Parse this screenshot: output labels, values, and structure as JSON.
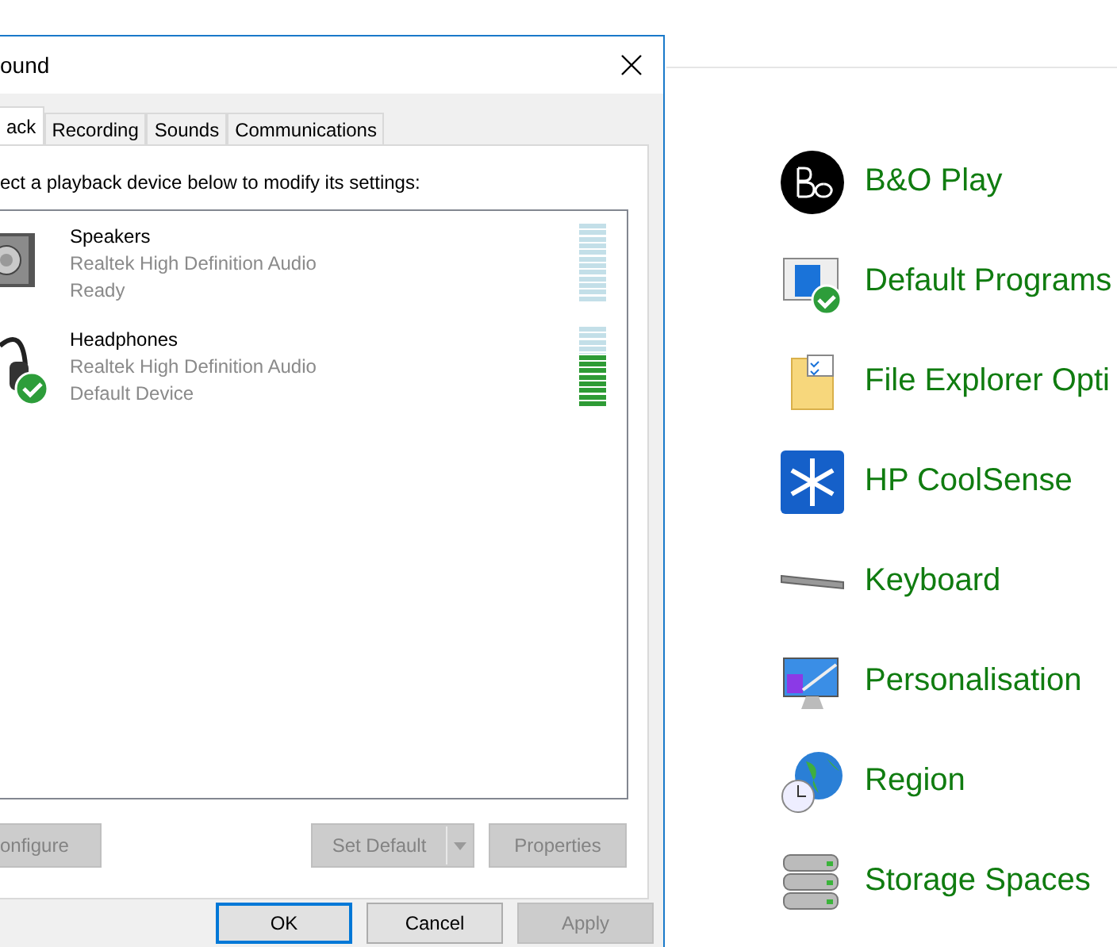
{
  "dialog": {
    "title": "ound",
    "tabs": [
      {
        "label": "ack",
        "selected": true
      },
      {
        "label": "Recording",
        "selected": false
      },
      {
        "label": "Sounds",
        "selected": false
      },
      {
        "label": "Communications",
        "selected": false
      }
    ],
    "instruction": "ect a playback device below to modify its settings:",
    "devices": [
      {
        "kind": "speaker",
        "name": "Speakers",
        "driver": "Realtek High Definition Audio",
        "status": "Ready",
        "default": false,
        "level": 0
      },
      {
        "kind": "headphones",
        "name": "Headphones",
        "driver": "Realtek High Definition Audio",
        "status": "Default Device",
        "default": true,
        "level": 0.67
      }
    ],
    "device_buttons": [
      {
        "kind": "plain",
        "label": "onfigure",
        "disabled": true
      },
      {
        "kind": "split",
        "label": "Set Default",
        "disabled": true
      },
      {
        "kind": "plain",
        "label": "Properties",
        "disabled": true
      }
    ],
    "buttons": [
      {
        "label": "OK",
        "default": true,
        "disabled": false
      },
      {
        "label": "Cancel",
        "default": false,
        "disabled": false
      },
      {
        "label": "Apply",
        "default": false,
        "disabled": true
      }
    ]
  },
  "control_panel": {
    "items": [
      {
        "kind": "bo",
        "label": "B&O Play"
      },
      {
        "kind": "default-programs",
        "label": "Default Programs"
      },
      {
        "kind": "folder-options",
        "label": "File Explorer Opti"
      },
      {
        "kind": "snowflake",
        "label": "HP CoolSense"
      },
      {
        "kind": "keyboard",
        "label": "Keyboard"
      },
      {
        "kind": "monitor",
        "label": "Personalisation"
      },
      {
        "kind": "globe",
        "label": "Region"
      },
      {
        "kind": "drives",
        "label": "Storage Spaces"
      }
    ]
  }
}
